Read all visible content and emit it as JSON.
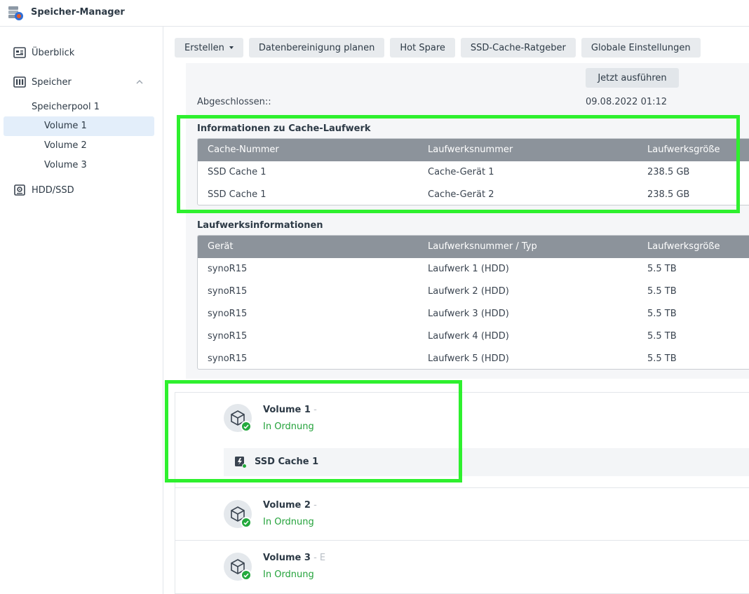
{
  "app": {
    "title": "Speicher-Manager"
  },
  "sidebar": {
    "overview": "Überblick",
    "storage": "Speicher",
    "pool": "Speicherpool 1",
    "volumes": [
      "Volume 1",
      "Volume 2",
      "Volume 3"
    ],
    "hdd": "HDD/SSD"
  },
  "toolbar": {
    "create": "Erstellen",
    "scrub": "Datenbereinigung planen",
    "hotspare": "Hot Spare",
    "ssd_advisor": "SSD-Cache-Ratgeber",
    "global": "Globale Einstellungen"
  },
  "detail": {
    "run_now": "Jetzt ausführen",
    "completed_label": "Abgeschlossen::",
    "completed_value": "09.08.2022 01:12",
    "cache_section": {
      "title": "Informationen zu Cache-Laufwerk",
      "headers": [
        "Cache-Nummer",
        "Laufwerksnummer",
        "Laufwerksgröße"
      ],
      "rows": [
        [
          "SSD Cache 1",
          "Cache-Gerät 1",
          "238.5 GB"
        ],
        [
          "SSD Cache 1",
          "Cache-Gerät 2",
          "238.5 GB"
        ]
      ]
    },
    "drive_section": {
      "title": "Laufwerksinformationen",
      "headers": [
        "Gerät",
        "Laufwerksnummer / Typ",
        "Laufwerksgröße"
      ],
      "rows": [
        [
          "synoR15",
          "Laufwerk 1 (HDD)",
          "5.5 TB"
        ],
        [
          "synoR15",
          "Laufwerk 2 (HDD)",
          "5.5 TB"
        ],
        [
          "synoR15",
          "Laufwerk 3 (HDD)",
          "5.5 TB"
        ],
        [
          "synoR15",
          "Laufwerk 4 (HDD)",
          "5.5 TB"
        ],
        [
          "synoR15",
          "Laufwerk 5 (HDD)",
          "5.5 TB"
        ]
      ]
    }
  },
  "volume_list": [
    {
      "name": "Volume 1",
      "desc": " - ",
      "status": "In Ordnung",
      "cache": "SSD Cache 1"
    },
    {
      "name": "Volume 2",
      "desc": " - ",
      "status": "In Ordnung"
    },
    {
      "name": "Volume 3",
      "desc": " - E",
      "status": "In Ordnung"
    }
  ],
  "colors": {
    "highlight": "#2ef02e",
    "status_ok": "#23a23a",
    "table_header": "#8c939b",
    "active_nav": "#e3eefa"
  }
}
